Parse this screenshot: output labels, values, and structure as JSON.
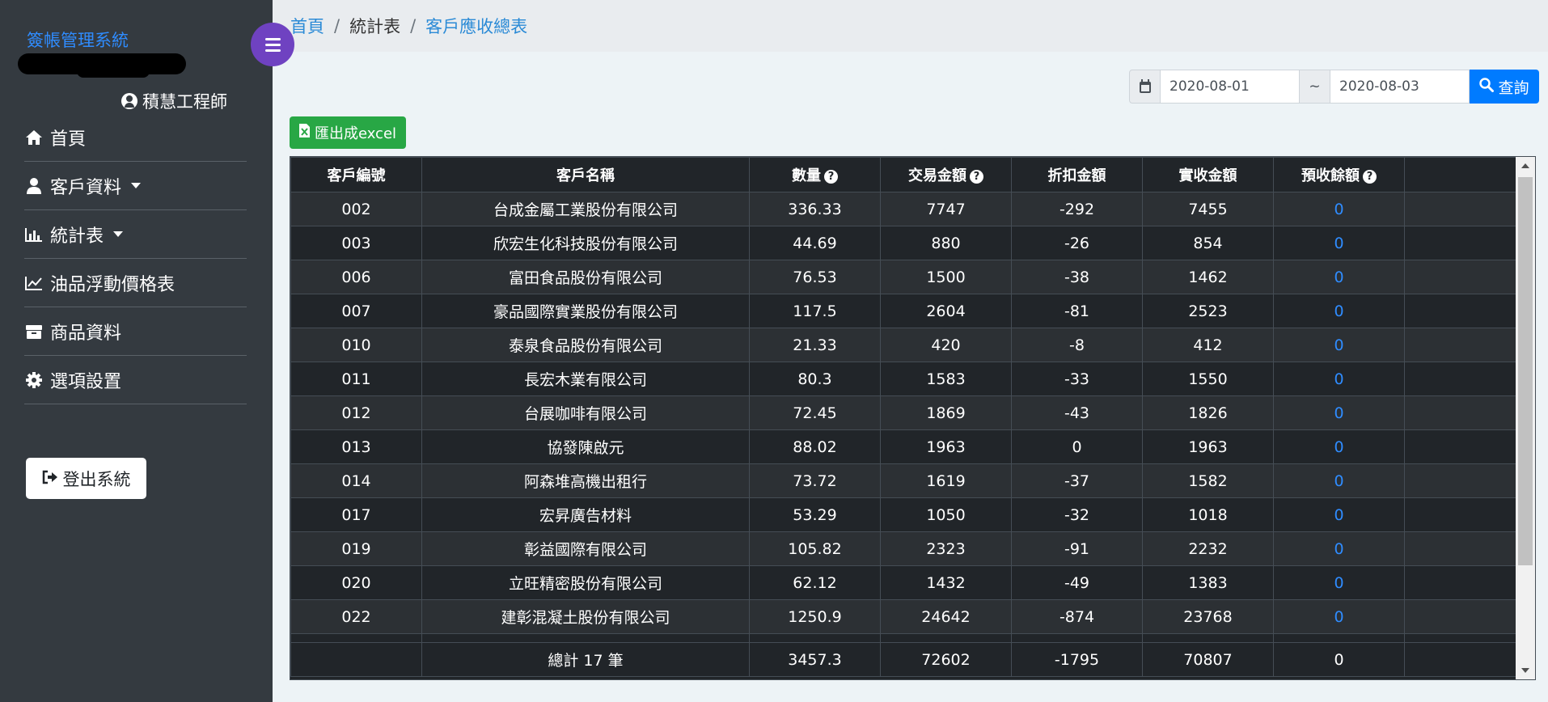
{
  "sidebar": {
    "brand": "簽帳管理系統",
    "user": "積慧工程師",
    "items": [
      {
        "label": "首頁",
        "icon": "home-icon",
        "caret": false
      },
      {
        "label": "客戶資料",
        "icon": "user-icon",
        "caret": true
      },
      {
        "label": "統計表",
        "icon": "bar-chart-icon",
        "caret": true
      },
      {
        "label": "油品浮動價格表",
        "icon": "line-chart-icon",
        "caret": false
      },
      {
        "label": "商品資料",
        "icon": "box-icon",
        "caret": false
      },
      {
        "label": "選項設置",
        "icon": "gear-icon",
        "caret": false
      }
    ],
    "logout": "登出系統"
  },
  "breadcrumb": {
    "home": "首頁",
    "section": "統計表",
    "current": "客戶應收總表"
  },
  "filters": {
    "date_from": "2020-08-01",
    "separator": "~",
    "date_to": "2020-08-03",
    "search_label": "查詢"
  },
  "export_label": "匯出成excel",
  "table": {
    "headers": [
      "客戶編號",
      "客戶名稱",
      "數量",
      "交易金額",
      "折扣金額",
      "實收金額",
      "預收餘額"
    ],
    "rows": [
      [
        "002",
        "台成金屬工業股份有限公司",
        "336.33",
        "7747",
        "-292",
        "7455",
        "0"
      ],
      [
        "003",
        "欣宏生化科技股份有限公司",
        "44.69",
        "880",
        "-26",
        "854",
        "0"
      ],
      [
        "006",
        "富田食品股份有限公司",
        "76.53",
        "1500",
        "-38",
        "1462",
        "0"
      ],
      [
        "007",
        "豪品國際實業股份有限公司",
        "117.5",
        "2604",
        "-81",
        "2523",
        "0"
      ],
      [
        "010",
        "泰泉食品股份有限公司",
        "21.33",
        "420",
        "-8",
        "412",
        "0"
      ],
      [
        "011",
        "長宏木業有限公司",
        "80.3",
        "1583",
        "-33",
        "1550",
        "0"
      ],
      [
        "012",
        "台展咖啡有限公司",
        "72.45",
        "1869",
        "-43",
        "1826",
        "0"
      ],
      [
        "013",
        "協發陳啟元",
        "88.02",
        "1963",
        "0",
        "1963",
        "0"
      ],
      [
        "014",
        "阿森堆高機出租行",
        "73.72",
        "1619",
        "-37",
        "1582",
        "0"
      ],
      [
        "017",
        "宏昇廣告材料",
        "53.29",
        "1050",
        "-32",
        "1018",
        "0"
      ],
      [
        "019",
        "彰益國際有限公司",
        "105.82",
        "2323",
        "-91",
        "2232",
        "0"
      ],
      [
        "020",
        "立旺精密股份有限公司",
        "62.12",
        "1432",
        "-49",
        "1383",
        "0"
      ],
      [
        "022",
        "建彰混凝土股份有限公司",
        "1250.9",
        "24642",
        "-874",
        "23768",
        "0"
      ]
    ],
    "total": [
      "",
      "總計 17 筆",
      "3457.3",
      "72602",
      "-1795",
      "70807",
      "0"
    ]
  }
}
